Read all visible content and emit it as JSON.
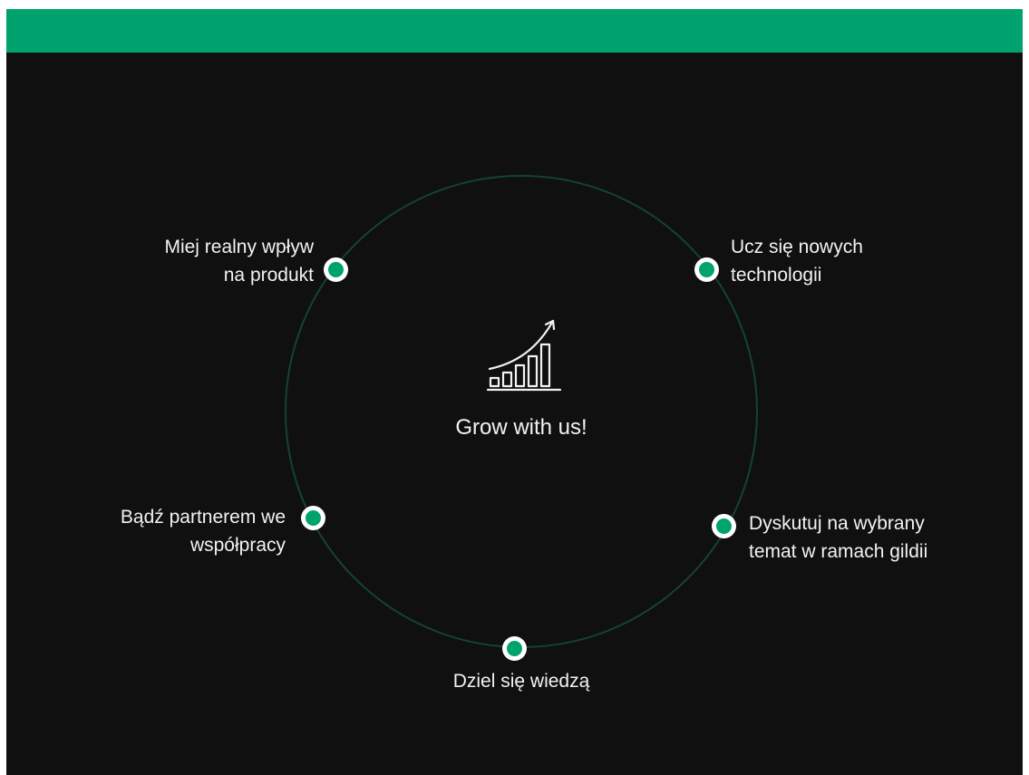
{
  "colors": {
    "accent": "#00a36e",
    "background": "#101010",
    "ring": "#14442f",
    "text": "#f2f2f2",
    "dot_outline": "#ffffff"
  },
  "center": {
    "icon": "growth-chart-icon",
    "title": "Grow with us!"
  },
  "points": [
    {
      "id": "impact",
      "label": "Miej realny wpływ\nna produkt"
    },
    {
      "id": "learn",
      "label": "Ucz się nowych\ntechnologii"
    },
    {
      "id": "partner",
      "label": "Bądź partnerem we\nwspółpracy"
    },
    {
      "id": "discuss",
      "label": "Dyskutuj na wybrany\ntemat w ramach gildii"
    },
    {
      "id": "share",
      "label": "Dziel się wiedzą"
    }
  ]
}
